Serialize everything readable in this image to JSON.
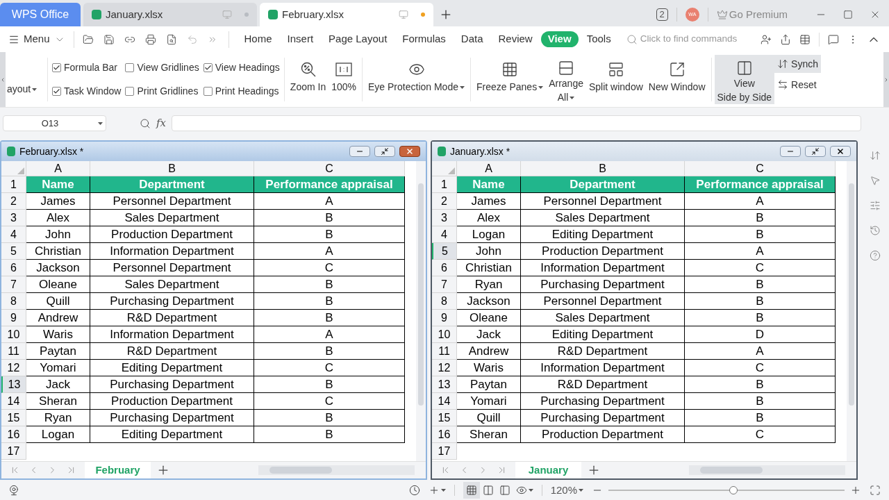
{
  "doc_tabs": [
    {
      "kind": "home",
      "label": "WPS Office",
      "selected": false
    },
    {
      "kind": "file",
      "label": "January.xlsx",
      "selected": false,
      "modified": false
    },
    {
      "kind": "file",
      "label": "February.xlsx",
      "selected": true,
      "modified": true
    }
  ],
  "title_bar": {
    "window_count": "2",
    "avatar": "WA",
    "premium": "Go Premium"
  },
  "menu": {
    "label": "Menu"
  },
  "ribbon_tabs": [
    {
      "label": "Home",
      "selected": false
    },
    {
      "label": "Insert",
      "selected": false
    },
    {
      "label": "Page Layout",
      "selected": false
    },
    {
      "label": "Formulas",
      "selected": false
    },
    {
      "label": "Data",
      "selected": false
    },
    {
      "label": "Review",
      "selected": false
    },
    {
      "label": "View",
      "selected": true
    },
    {
      "label": "Tools",
      "selected": false
    }
  ],
  "search": {
    "placeholder": "Click to find commands"
  },
  "ribbon": {
    "cut_button": {
      "label": "ayout",
      "dropdown": true
    },
    "checkboxes": [
      {
        "label": "Formula Bar",
        "checked": true
      },
      {
        "label": "Task Window",
        "checked": true
      },
      {
        "label": "View Gridlines",
        "checked": false
      },
      {
        "label": "Print Gridlines",
        "checked": false
      },
      {
        "label": "View Headings",
        "checked": true
      },
      {
        "label": "Print Headings",
        "checked": false
      }
    ],
    "groups": [
      {
        "buttons": [
          {
            "lines": [
              "Zoom In"
            ],
            "dropdown": false
          },
          {
            "lines": [
              "100%"
            ],
            "dropdown": false
          }
        ]
      },
      {
        "buttons": [
          {
            "lines": [
              "Eye Protection Mode"
            ],
            "dropdown": true
          }
        ]
      },
      {
        "buttons": [
          {
            "lines": [
              "Freeze Panes"
            ],
            "dropdown": true
          },
          {
            "lines": [
              "Arrange",
              "All"
            ],
            "dropdown": true
          },
          {
            "lines": [
              "Split window"
            ],
            "dropdown": false
          },
          {
            "lines": [
              "New Window"
            ],
            "dropdown": false
          }
        ]
      },
      {
        "buttons": [
          {
            "lines": [
              "View",
              "Side by Side"
            ],
            "dropdown": false,
            "selected": true
          }
        ]
      }
    ],
    "small_buttons": [
      {
        "label": "Synch",
        "selected": true
      },
      {
        "label": "Reset",
        "selected": false
      }
    ]
  },
  "formula_bar": {
    "name_box": "O13",
    "function_label": "fx"
  },
  "windows": [
    {
      "title": "February.xlsx *",
      "active": true,
      "columns": [
        "A",
        "B",
        "C"
      ],
      "header_row": {
        "number": "1",
        "cells": [
          "Name",
          "Department",
          "Performance appraisal"
        ]
      },
      "rows": [
        {
          "number": "2",
          "selected": false,
          "cells": [
            "James",
            "Personnel Department",
            "A"
          ]
        },
        {
          "number": "3",
          "selected": false,
          "cells": [
            "Alex",
            "Sales Department",
            "B"
          ]
        },
        {
          "number": "4",
          "selected": false,
          "cells": [
            "John",
            "Production Department",
            "B"
          ]
        },
        {
          "number": "5",
          "selected": false,
          "cells": [
            "Christian",
            "Information Department",
            "A"
          ]
        },
        {
          "number": "6",
          "selected": false,
          "cells": [
            "Jackson",
            "Personnel Department",
            "C"
          ]
        },
        {
          "number": "7",
          "selected": false,
          "cells": [
            "Oleane",
            "Sales Department",
            "B"
          ]
        },
        {
          "number": "8",
          "selected": false,
          "cells": [
            "Quill",
            "Purchasing Department",
            "B"
          ]
        },
        {
          "number": "9",
          "selected": false,
          "cells": [
            "Andrew",
            "R&D Department",
            "B"
          ]
        },
        {
          "number": "10",
          "selected": false,
          "cells": [
            "Waris",
            "Information Department",
            "A"
          ]
        },
        {
          "number": "11",
          "selected": false,
          "cells": [
            "Paytan",
            "R&D Department",
            "B"
          ]
        },
        {
          "number": "12",
          "selected": false,
          "cells": [
            "Yomari",
            "Editing Department",
            "C"
          ]
        },
        {
          "number": "13",
          "selected": true,
          "cells": [
            "Jack",
            "Purchasing Department",
            "B"
          ]
        },
        {
          "number": "14",
          "selected": false,
          "cells": [
            "Sheran",
            "Production Department",
            "C"
          ]
        },
        {
          "number": "15",
          "selected": false,
          "cells": [
            "Ryan",
            "Purchasing Department",
            "B"
          ]
        },
        {
          "number": "16",
          "selected": false,
          "cells": [
            "Logan",
            "Editing Department",
            "B"
          ]
        },
        {
          "number": "17",
          "selected": false,
          "cells": []
        }
      ],
      "sheet_tab": "February"
    },
    {
      "title": "January.xlsx *",
      "active": false,
      "columns": [
        "A",
        "B",
        "C"
      ],
      "header_row": {
        "number": "1",
        "cells": [
          "Name",
          "Department",
          "Performance appraisal"
        ]
      },
      "rows": [
        {
          "number": "2",
          "selected": false,
          "cells": [
            "James",
            "Personnel Department",
            "A"
          ]
        },
        {
          "number": "3",
          "selected": false,
          "cells": [
            "Alex",
            "Sales Department",
            "B"
          ]
        },
        {
          "number": "4",
          "selected": false,
          "cells": [
            "Logan",
            "Editing Department",
            "B"
          ]
        },
        {
          "number": "5",
          "selected": true,
          "cells": [
            "John",
            "Production Department",
            "A"
          ]
        },
        {
          "number": "6",
          "selected": false,
          "cells": [
            "Christian",
            "Information Department",
            "C"
          ]
        },
        {
          "number": "7",
          "selected": false,
          "cells": [
            "Ryan",
            "Purchasing Department",
            "B"
          ]
        },
        {
          "number": "8",
          "selected": false,
          "cells": [
            "Jackson",
            "Personnel Department",
            "B"
          ]
        },
        {
          "number": "9",
          "selected": false,
          "cells": [
            "Oleane",
            "Sales Department",
            "B"
          ]
        },
        {
          "number": "10",
          "selected": false,
          "cells": [
            "Jack",
            "Editing Department",
            "D"
          ]
        },
        {
          "number": "11",
          "selected": false,
          "cells": [
            "Andrew",
            "R&D Department",
            "A"
          ]
        },
        {
          "number": "12",
          "selected": false,
          "cells": [
            "Waris",
            "Information Department",
            "C"
          ]
        },
        {
          "number": "13",
          "selected": false,
          "cells": [
            "Paytan",
            "R&D Department",
            "B"
          ]
        },
        {
          "number": "14",
          "selected": false,
          "cells": [
            "Yomari",
            "Purchasing Department",
            "B"
          ]
        },
        {
          "number": "15",
          "selected": false,
          "cells": [
            "Quill",
            "Purchasing Department",
            "B"
          ]
        },
        {
          "number": "16",
          "selected": false,
          "cells": [
            "Sheran",
            "Production Department",
            "C"
          ]
        },
        {
          "number": "17",
          "selected": false,
          "cells": []
        }
      ],
      "sheet_tab": "January"
    }
  ],
  "status_bar": {
    "view_modes": [
      {
        "selected": true
      },
      {
        "selected": false
      },
      {
        "selected": false
      }
    ],
    "zoom": "120%",
    "level": 0.53
  }
}
